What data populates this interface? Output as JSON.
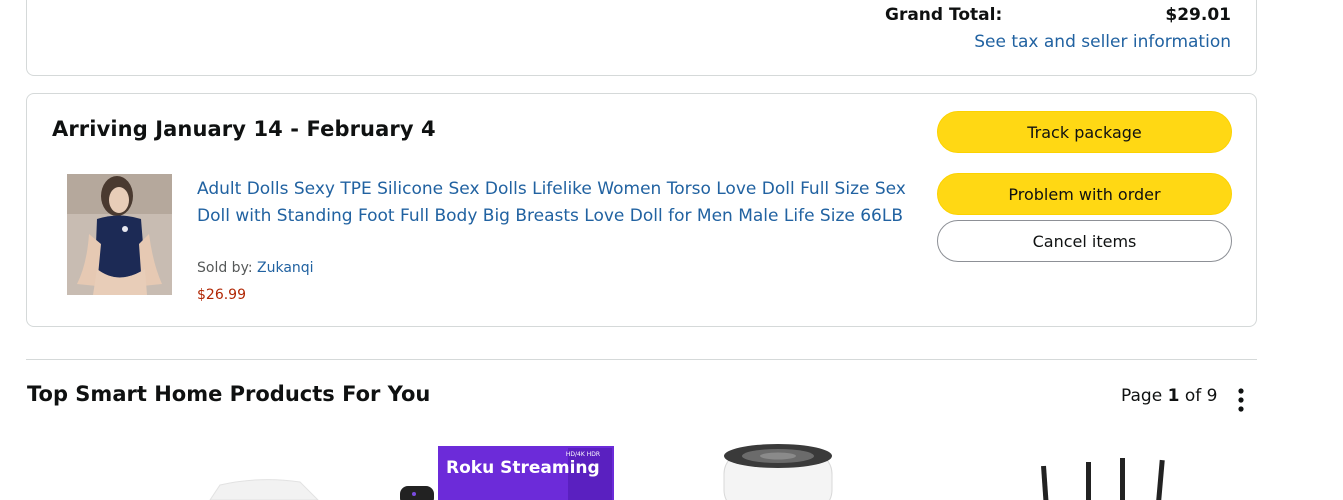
{
  "summary": {
    "grand_total_label": "Grand Total:",
    "grand_total_value": "$29.01",
    "tax_link": "See tax and seller information"
  },
  "shipment": {
    "arrival": "Arriving January 14 - February 4",
    "product": {
      "title": "Adult Dolls Sexy TPE Silicone Sex Dolls Lifelike Women Torso Love Doll Full Size Sex Doll with Standing Foot Full Body Big Breasts Love Doll for Men Male Life Size 66LB",
      "sold_by_label": "Sold by:",
      "seller": "Zukanqi",
      "price": "$26.99"
    },
    "buttons": {
      "track": "Track package",
      "problem": "Problem with order",
      "cancel": "Cancel items"
    }
  },
  "recommendations": {
    "title": "Top Smart Home Products For You",
    "pager_prefix": "Page",
    "page_current": "1",
    "pager_of": "of",
    "page_total": "9",
    "items": [
      {
        "icon": "smart-plug-image"
      },
      {
        "icon": "roku-streaming-stick-image",
        "box_text": "Roku Streaming",
        "badge": "HD/4K HDR"
      },
      {
        "icon": "air-purifier-image"
      },
      {
        "icon": "wifi-router-image"
      }
    ]
  },
  "colors": {
    "link": "#2162a1",
    "price": "#b12704",
    "button_yellow": "#ffd814",
    "roku_purple": "#6c2bd9"
  }
}
